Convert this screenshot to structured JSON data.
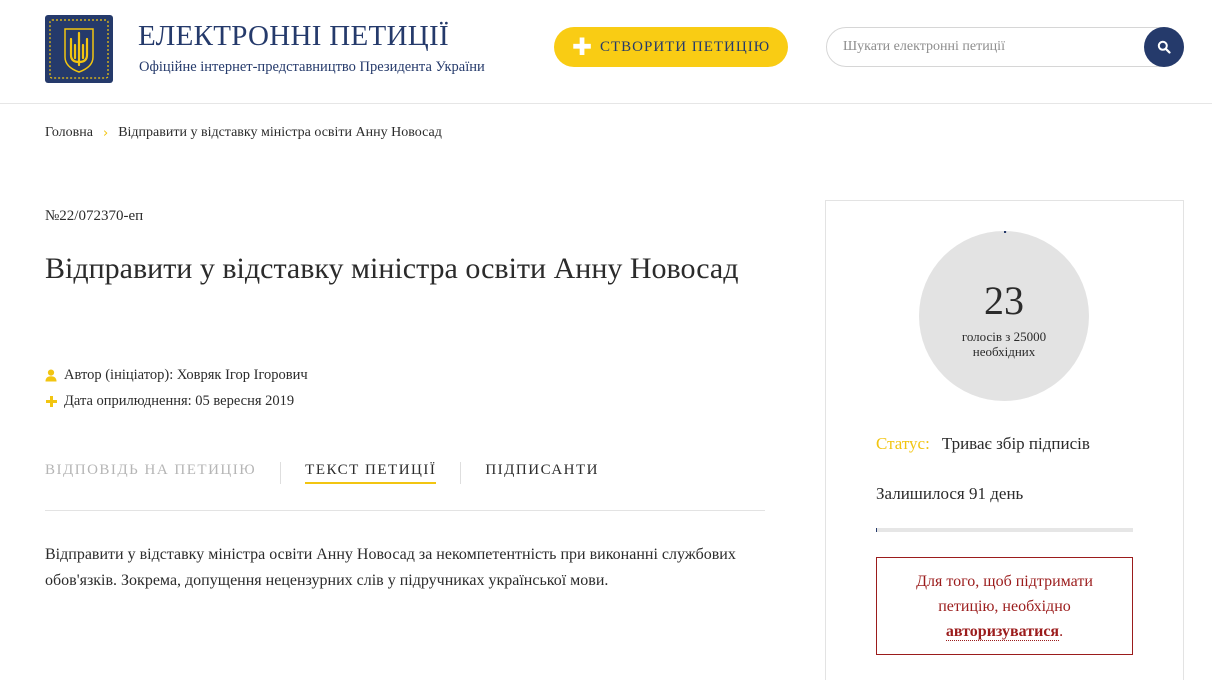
{
  "header": {
    "title": "ЕЛЕКТРОННІ ПЕТИЦІЇ",
    "subtitle": "Офіційне інтернет-представництво Президента України",
    "create_button": "СТВОРИТИ ПЕТИЦІЮ",
    "search_placeholder": "Шукати електронні петиції",
    "search_value": "",
    "logo_icon": "trident-coat-of-arms-icon",
    "brand_color": "#253a6b",
    "accent_color": "#f9cc14"
  },
  "breadcrumb": {
    "home": "Головна",
    "current": "Відправити у відставку міністра освіти Анну Новосад"
  },
  "petition": {
    "number": "№22/072370-еп",
    "title": "Відправити у відставку міністра освіти Анну Новосад",
    "author_label": "Автор (ініціатор):",
    "author": "Ховряк Ігор Ігорович",
    "date_label": "Дата оприлюднення:",
    "date": "05 вересня 2019",
    "text": "Відправити у відставку міністра освіти Анну Новосад за некомпетентність при виконанні службових обов'язків. Зокрема, допущення нецензурних слів у підручниках української мови."
  },
  "tabs": [
    {
      "label": "ВІДПОВІДЬ НА ПЕТИЦІЮ",
      "active": false,
      "disabled": true
    },
    {
      "label": "ТЕКСТ ПЕТИЦІЇ",
      "active": true,
      "disabled": false
    },
    {
      "label": "ПІДПИСАНТИ",
      "active": false,
      "disabled": false
    }
  ],
  "panel": {
    "votes_count": "23",
    "votes_label": "голосів з 25000 необхідних",
    "votes_current": 23,
    "votes_required": 25000,
    "status_label": "Статус:",
    "status_value": "Триває збір підписів",
    "remaining": "Залишилося 91 день",
    "progress_fraction": 0.0009,
    "auth_text": "Для того, щоб підтримати петицію, необхідно",
    "auth_link": "авторизуватися",
    "auth_suffix": ".",
    "alert_color": "#9b1c1c"
  }
}
